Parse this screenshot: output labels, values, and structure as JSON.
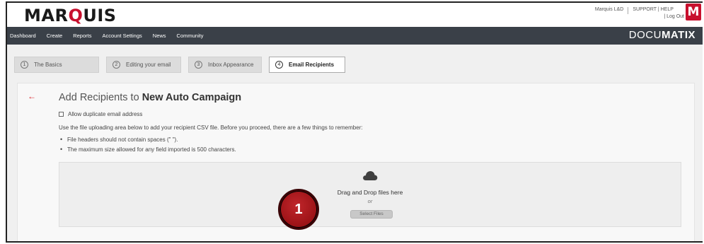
{
  "header": {
    "logo_text_a": "MAR",
    "logo_text_b": "Q",
    "logo_text_c": "UIS",
    "user_name": "Marquis L&D",
    "support_help": "SUPPORT | HELP",
    "log_out": "| Log Out",
    "badge_letter": "M"
  },
  "nav": {
    "items": [
      "Dashboard",
      "Create",
      "Reports",
      "Account Settings",
      "News",
      "Community"
    ],
    "brand_light": "DOCU",
    "brand_bold": "MATIX"
  },
  "steps": [
    {
      "num": "1",
      "label": "The Basics"
    },
    {
      "num": "2",
      "label": "Editing your email"
    },
    {
      "num": "3",
      "label": "Inbox Appearance"
    },
    {
      "num": "4",
      "label": "Email Recipients"
    }
  ],
  "content": {
    "back_icon": "arrow-left-icon",
    "title_prefix": "Add Recipients to ",
    "title_bold": "New Auto Campaign",
    "checkbox_label": "Allow duplicate email address",
    "instructions": "Use the file uploading area below to add your recipient CSV file. Before you proceed, there are a few things to remember:",
    "bullets": [
      "File headers should not contain spaces (\" \").",
      "The maximum size allowed for any field imported is 500 characters."
    ]
  },
  "dropzone": {
    "icon": "cloud-icon",
    "text": "Drag and Drop files here",
    "or": "or",
    "button": "Select Files"
  },
  "callout": {
    "number": "1"
  },
  "colors": {
    "brand_red": "#c8102e",
    "nav_bg": "#3a4048",
    "callout_red": "#9b1216"
  }
}
